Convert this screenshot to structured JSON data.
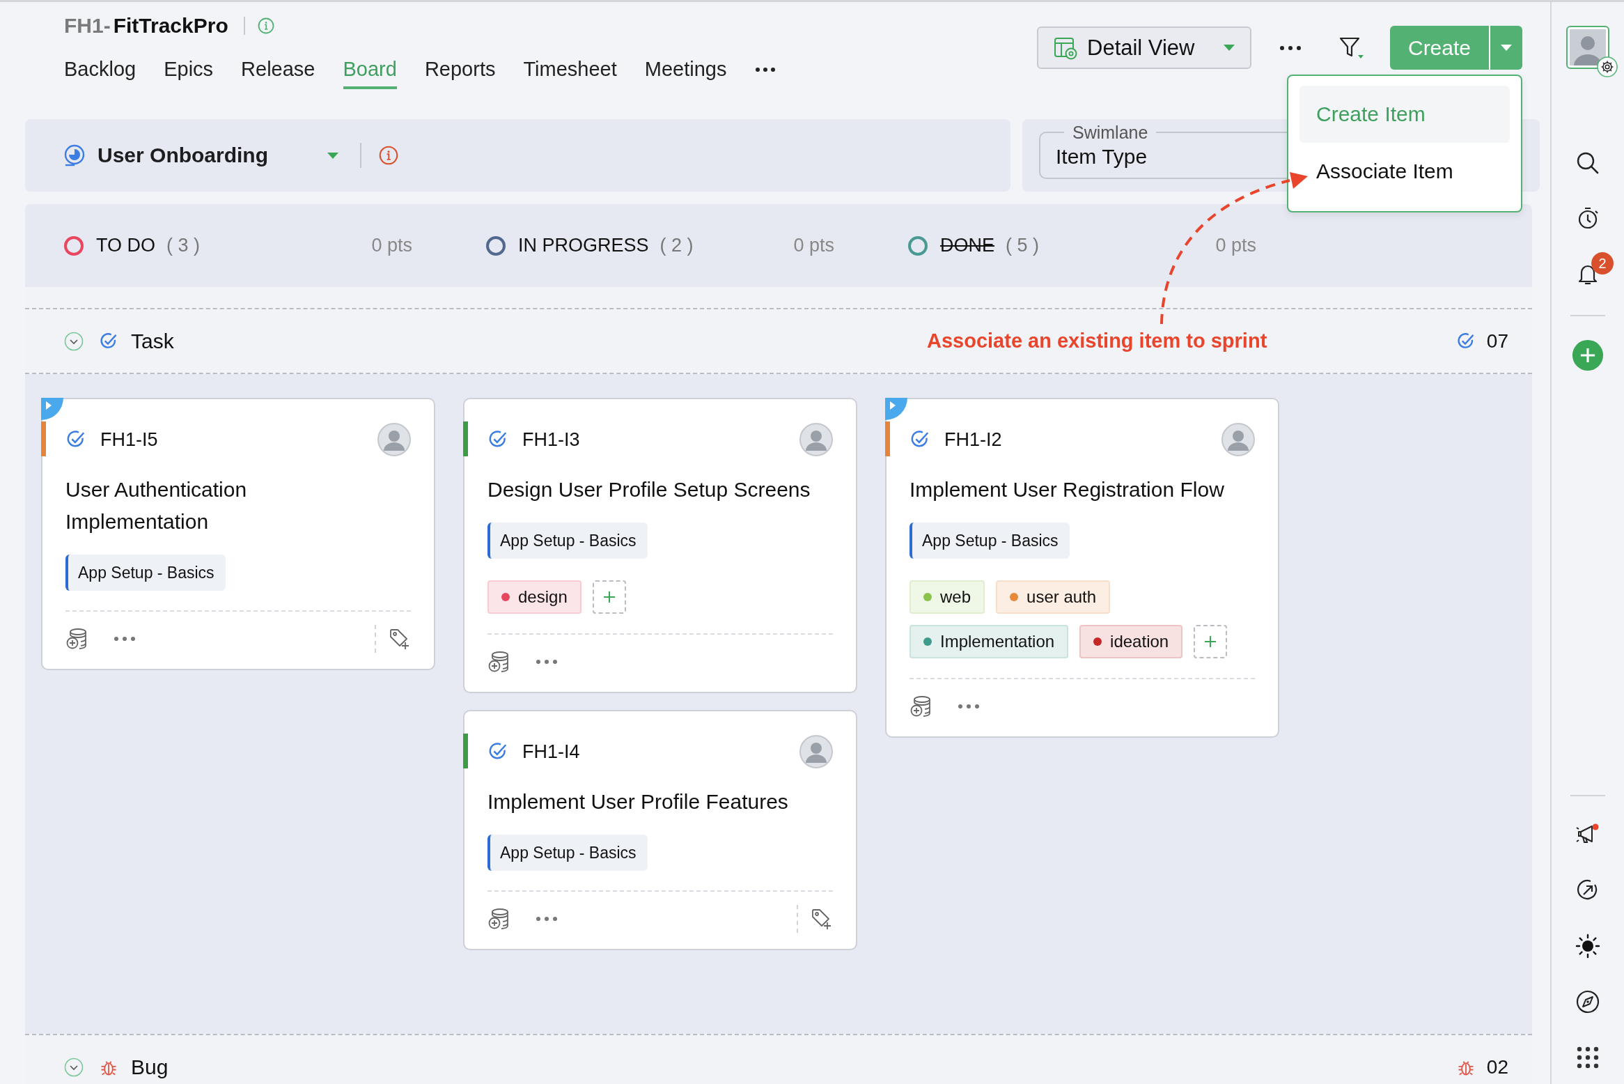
{
  "project": {
    "prefix": "FH1-",
    "name": "FitTrackPro"
  },
  "nav": [
    {
      "label": "Backlog",
      "selected": false
    },
    {
      "label": "Epics",
      "selected": false
    },
    {
      "label": "Release",
      "selected": false
    },
    {
      "label": "Board",
      "selected": true
    },
    {
      "label": "Reports",
      "selected": false
    },
    {
      "label": "Timesheet",
      "selected": false
    },
    {
      "label": "Meetings",
      "selected": false
    }
  ],
  "toolbar": {
    "view": "Detail View",
    "create": "Create"
  },
  "create_menu": [
    {
      "label": "Create Item",
      "selected": true
    },
    {
      "label": "Associate Item",
      "selected": false
    }
  ],
  "sprint": {
    "name": "User Onboarding"
  },
  "swimlane": {
    "label": "Swimlane",
    "value": "Item Type"
  },
  "columns": [
    {
      "name": "TO DO",
      "count": "( 3 )",
      "points": "0 pts",
      "color": "#e8475f",
      "struck": false
    },
    {
      "name": "IN PROGRESS",
      "count": "( 2 )",
      "points": "0 pts",
      "color": "#52698f",
      "struck": false
    },
    {
      "name": "DONE",
      "count": "( 5 )",
      "points": "0 pts",
      "color": "#4a9a94",
      "struck": true
    }
  ],
  "lanes": [
    {
      "kind": "task",
      "name": "Task",
      "count": "07",
      "cells": [
        [
          {
            "id": "FH1-I5",
            "title": "User Authentication Implementation",
            "epic": "App Setup - Basics",
            "color": "#e5843a",
            "corner_flag": true
          }
        ],
        [
          {
            "id": "FH1-I3",
            "title": "Design User Profile Setup Screens",
            "epic": "App Setup - Basics",
            "color": "#3f9a45",
            "corner_flag": false,
            "tags": [
              {
                "label": "design",
                "color": "#e5485d"
              }
            ]
          },
          {
            "id": "FH1-I4",
            "title": "Implement User Profile Features",
            "epic": "App Setup - Basics",
            "color": "#3f9a45",
            "corner_flag": false
          }
        ],
        [
          {
            "id": "FH1-I2",
            "title": "Implement User Registration Flow",
            "epic": "App Setup - Basics",
            "color": "#e5843a",
            "corner_flag": true,
            "tags": [
              {
                "label": "web",
                "color": "#8bc34a"
              },
              {
                "label": "user auth",
                "color": "#e8893a"
              },
              {
                "label": "Implementation",
                "color": "#3f9a8c"
              },
              {
                "label": "ideation",
                "color": "#c62828"
              }
            ]
          }
        ]
      ]
    },
    {
      "kind": "bug",
      "name": "Bug",
      "count": "02"
    }
  ],
  "annotation": "Associate an existing item to sprint",
  "sidebar": {
    "notifications": "2"
  }
}
